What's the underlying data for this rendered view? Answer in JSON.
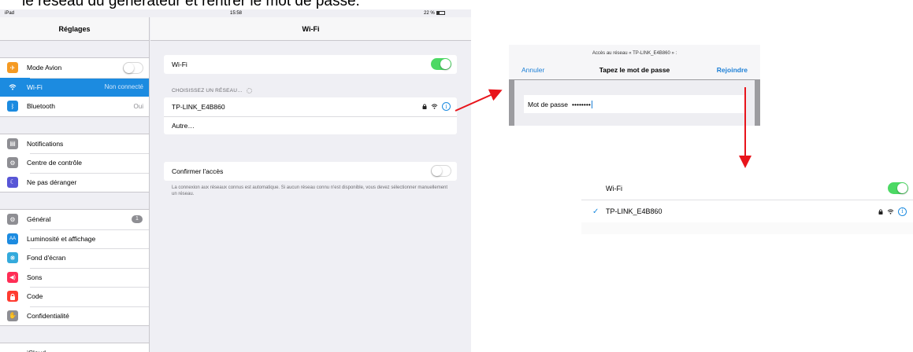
{
  "caption": "le réseau du générateur et rentrer le mot de passe.",
  "ipad": {
    "status": {
      "carrier": "iPad",
      "time": "15:58",
      "battery": "22 %"
    },
    "sidebar": {
      "title": "Réglages",
      "group1": [
        {
          "label": "Mode Avion",
          "icon": "airplane-icon",
          "icon_color": "#f59a23",
          "toggle": "off"
        },
        {
          "label": "Wi-Fi",
          "icon": "wifi-icon",
          "icon_color": "#1c8be0",
          "value": "Non connecté",
          "selected": true
        },
        {
          "label": "Bluetooth",
          "icon": "bluetooth-icon",
          "icon_color": "#1c8be0",
          "value": "Oui"
        }
      ],
      "group2": [
        {
          "label": "Notifications",
          "icon": "notifications-icon",
          "icon_color": "#8e8e93"
        },
        {
          "label": "Centre de contrôle",
          "icon": "control-center-icon",
          "icon_color": "#8e8e93"
        },
        {
          "label": "Ne pas déranger",
          "icon": "moon-icon",
          "icon_color": "#5856d6"
        }
      ],
      "group3": [
        {
          "label": "Général",
          "icon": "gear-icon",
          "icon_color": "#8e8e93",
          "badge": "1"
        },
        {
          "label": "Luminosité et affichage",
          "icon": "brightness-icon",
          "icon_color": "#1c8be0"
        },
        {
          "label": "Fond d'écran",
          "icon": "wallpaper-icon",
          "icon_color": "#34aadc"
        },
        {
          "label": "Sons",
          "icon": "sound-icon",
          "icon_color": "#ff2d55"
        },
        {
          "label": "Code",
          "icon": "lock-icon",
          "icon_color": "#ff3b30"
        },
        {
          "label": "Confidentialité",
          "icon": "hand-icon",
          "icon_color": "#8e8e93"
        }
      ],
      "group4": [
        {
          "label": "iCloud",
          "icon": "cloud-icon",
          "icon_color": "#ffffff"
        }
      ]
    },
    "detail": {
      "title": "Wi-Fi",
      "wifi_label": "Wi-Fi",
      "wifi_toggle": "on",
      "section_label": "CHOISISSEZ UN RÉSEAU…",
      "network_name": "TP-LINK_E4B860",
      "other_label": "Autre…",
      "ask_label": "Confirmer l'accès",
      "ask_toggle": "off",
      "footnote": "La connexion aux réseaux connus est automatique. Si aucun réseau connu n'est disponible, vous devez sélectionner manuellement un réseau."
    }
  },
  "password_sheet": {
    "subtitle": "Accès au réseau « TP-LINK_E4B860 » :",
    "cancel": "Annuler",
    "title": "Tapez le mot de passe",
    "join": "Rejoindre",
    "field_label": "Mot de passe",
    "field_value": "••••••••"
  },
  "result": {
    "wifi_label": "Wi-Fi",
    "wifi_toggle": "on",
    "network_name": "TP-LINK_E4B860",
    "connected_mark": "✓"
  },
  "colors": {
    "accent": "#1c8be0",
    "toggle_on": "#4cd964",
    "arrow": "#e8141b"
  }
}
